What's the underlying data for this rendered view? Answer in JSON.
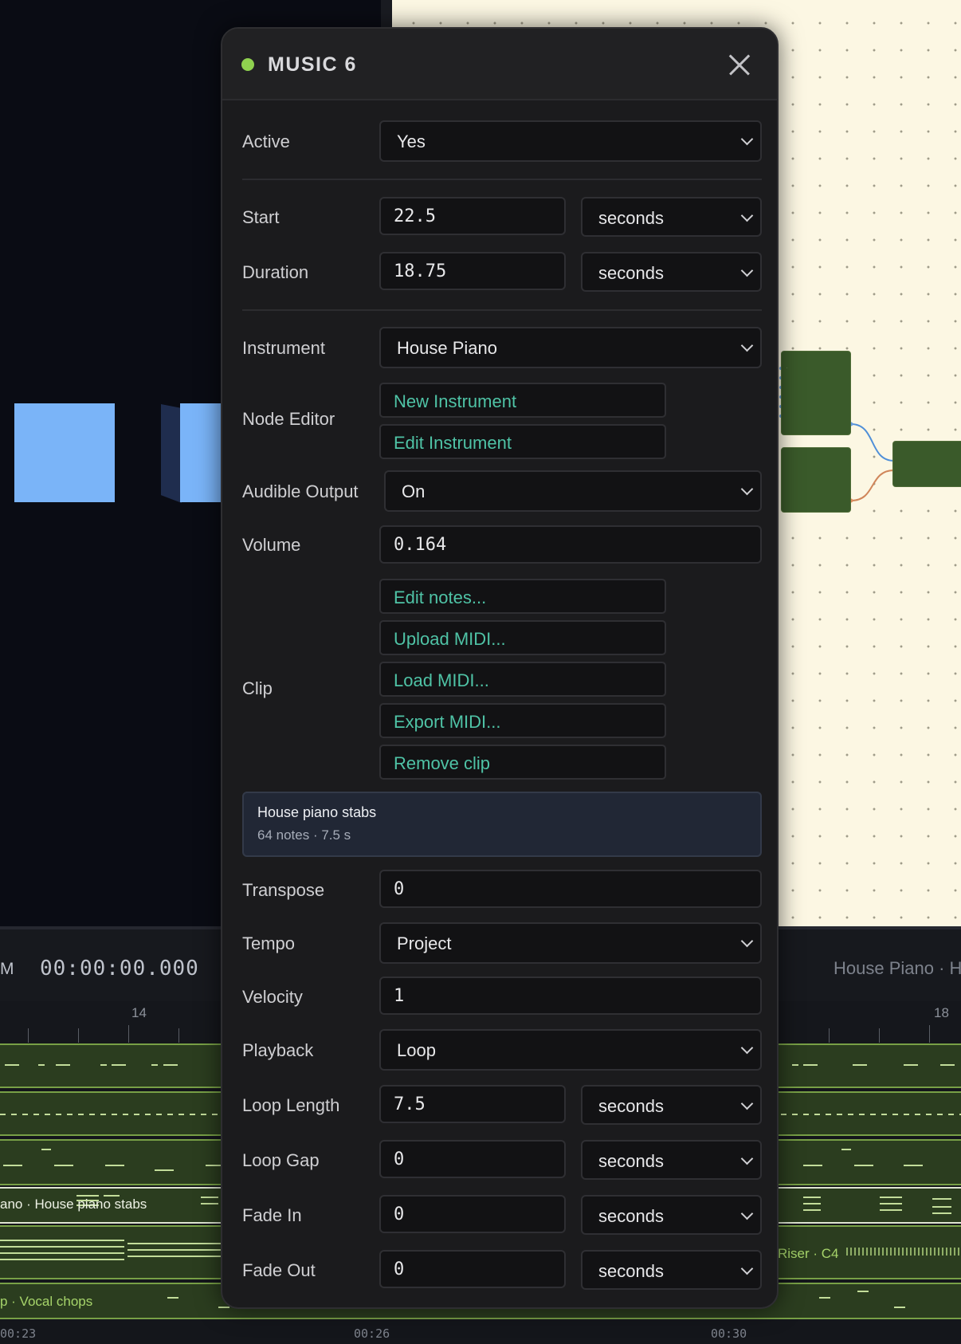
{
  "modal": {
    "title": "MUSIC 6",
    "status_color": "#8fd14f",
    "rows": {
      "active": {
        "label": "Active",
        "value": "Yes"
      },
      "start": {
        "label": "Start",
        "value": "22.5",
        "unit": "seconds"
      },
      "duration": {
        "label": "Duration",
        "value": "18.75",
        "unit": "seconds"
      },
      "instrument": {
        "label": "Instrument",
        "value": "House Piano"
      },
      "node_editor": {
        "label": "Node Editor",
        "new_label": "New Instrument",
        "edit_label": "Edit Instrument"
      },
      "audible_output": {
        "label": "Audible Output",
        "value": "On"
      },
      "volume": {
        "label": "Volume",
        "value": "0.164"
      },
      "clip": {
        "label": "Clip",
        "edit_notes": "Edit notes...",
        "upload_midi": "Upload MIDI...",
        "load_midi": "Load MIDI...",
        "export_midi": "Export MIDI...",
        "remove_clip": "Remove clip"
      },
      "clip_info": {
        "name": "House piano stabs",
        "meta": "64 notes · 7.5 s"
      },
      "transpose": {
        "label": "Transpose",
        "value": "0"
      },
      "tempo": {
        "label": "Tempo",
        "value": "Project"
      },
      "velocity": {
        "label": "Velocity",
        "value": "1"
      },
      "playback": {
        "label": "Playback",
        "value": "Loop"
      },
      "loop_length": {
        "label": "Loop Length",
        "value": "7.5",
        "unit": "seconds"
      },
      "loop_gap": {
        "label": "Loop Gap",
        "value": "0",
        "unit": "seconds"
      },
      "fade_in": {
        "label": "Fade In",
        "value": "0",
        "unit": "seconds"
      },
      "fade_out": {
        "label": "Fade Out",
        "value": "0",
        "unit": "seconds"
      }
    }
  },
  "timeline": {
    "clock": "00:00:00.000",
    "mode_fragment": "M",
    "right_info": "House Piano · H",
    "ruler_labels": {
      "r14": "14",
      "r18": "18"
    },
    "track_labels": {
      "piano": "ano · House piano stabs",
      "riser": "Riser · C4",
      "vocal": "p · Vocal chops"
    },
    "bottom_times": {
      "t1": "00:23",
      "t2": "00:26",
      "t3": "00:30"
    }
  },
  "colors": {
    "accent_link": "#4fc3a6",
    "track_fill": "#2b3d1f",
    "track_border": "#78a046",
    "node_canvas": "#fcf7e3",
    "cube": "#7ab4f8"
  }
}
